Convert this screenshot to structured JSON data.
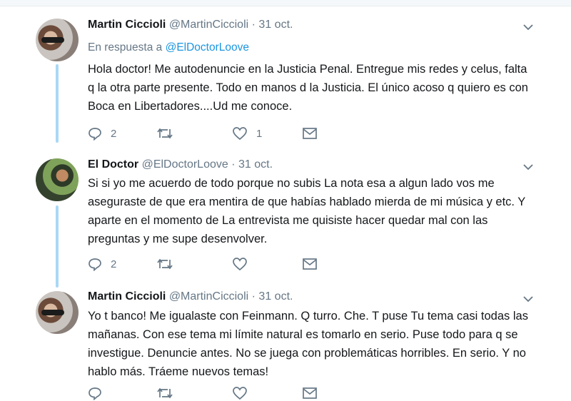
{
  "tweets": [
    {
      "name": "Martin Ciccioli",
      "handle": "@MartinCiccioli",
      "date": "31 oct.",
      "reply_prefix": "En respuesta a",
      "reply_handle": "@ElDoctorLoove",
      "text": "Hola doctor! Me autodenuncie en la Justicia Penal. Entregue mis redes y celus, falta q la otra parte presente. Todo en manos d la Justicia. El único acoso q quiero es con Boca en Libertadores....Ud me conoce.",
      "reply_count": "2",
      "retweet_count": "",
      "like_count": "1"
    },
    {
      "name": "El Doctor",
      "handle": "@ElDoctorLoove",
      "date": "31 oct.",
      "text": "Si si yo me acuerdo de todo porque no subis La nota esa a algun lado vos me aseguraste de que era mentira de que habías hablado mierda de mi música y etc. Y aparte en el momento de La entrevista me quisiste hacer quedar mal con las preguntas y me supe desenvolver.",
      "reply_count": "2",
      "retweet_count": "",
      "like_count": ""
    },
    {
      "name": "Martin Ciccioli",
      "handle": "@MartinCiccioli",
      "date": "31 oct.",
      "text": "Yo t banco! Me igualaste con Feinmann. Q turro. Che. T puse Tu tema casi todas las mañanas. Con ese tema mi límite natural es tomarlo en serio. Puse todo para q se investigue. Denuncie antes. No se juega con problemáticas horribles. En serio. Y no hablo más. Tráeme nuevos temas!"
    }
  ],
  "separator": "·",
  "colors": {
    "accent": "#1b95e0",
    "thread_line": "#aad8f6",
    "muted": "#657786"
  },
  "icons": [
    "chevron-down-icon",
    "reply-icon",
    "retweet-icon",
    "like-icon",
    "message-icon"
  ]
}
